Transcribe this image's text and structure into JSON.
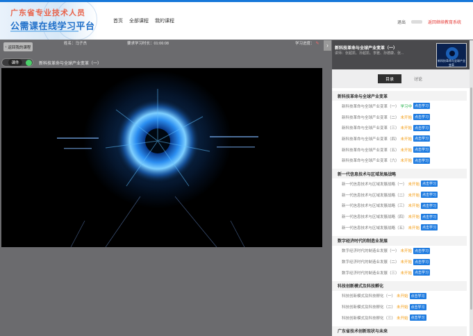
{
  "header": {
    "logo_line1": "广东省专业技术人员",
    "logo_line2": "公需课在线学习平台",
    "nav": [
      "首页",
      "全部课程",
      "我的课程"
    ],
    "logout": "退出",
    "home_link": "返回继续教育系统"
  },
  "player": {
    "back_label": "返回我的课程",
    "name_label": "姓名：马子杰",
    "duration_label": "要求学习时长：01:06:08",
    "progress_label": "学习进度：",
    "toggle_label": "课件",
    "now_playing": "新科技革命与全球产业变革（一）"
  },
  "panel": {
    "course_title": "新科技革命与全球产业变革（一）",
    "teachers": "讲师：张超凯、孙超凯、李雅、孙德康、张...",
    "thumb_text": "新科技革命与全球产业变革",
    "tabs": [
      "目录",
      "讨论"
    ]
  },
  "catalog": [
    {
      "section": "新科技革命与全球产业变革",
      "items": [
        {
          "title": "新科技革命与全球产业变革（一）",
          "status": "学习中",
          "state": "learning",
          "btn": "点击学习"
        },
        {
          "title": "新科技革命与全球产业变革（二）",
          "status": "未开始",
          "state": "notlearn",
          "btn": "点击学习"
        },
        {
          "title": "新科技革命与全球产业变革（三）",
          "status": "未开始",
          "state": "notlearn",
          "btn": "点击学习"
        },
        {
          "title": "新科技革命与全球产业变革（四）",
          "status": "未开始",
          "state": "notlearn",
          "btn": "点击学习"
        },
        {
          "title": "新科技革命与全球产业变革（五）",
          "status": "未开始",
          "state": "notlearn",
          "btn": "点击学习"
        },
        {
          "title": "新科技革命与全球产业变革（六）",
          "status": "未开始",
          "state": "notlearn",
          "btn": "点击学习"
        }
      ]
    },
    {
      "section": "新一代信息技术与区域发展战略",
      "items": [
        {
          "title": "新一代信息技术与区域发展战略（一）",
          "status": "未开始",
          "state": "notlearn",
          "btn": "点击学习"
        },
        {
          "title": "新一代信息技术与区域发展战略（二）",
          "status": "未开始",
          "state": "notlearn",
          "btn": "点击学习"
        },
        {
          "title": "新一代信息技术与区域发展战略（三）",
          "status": "未开始",
          "state": "notlearn",
          "btn": "点击学习"
        },
        {
          "title": "新一代信息技术与区域发展战略（四）",
          "status": "未开始",
          "state": "notlearn",
          "btn": "点击学习"
        },
        {
          "title": "新一代信息技术与区域发展战略（五）",
          "status": "未开始",
          "state": "notlearn",
          "btn": "点击学习"
        }
      ]
    },
    {
      "section": "数字经济时代的制造业发展",
      "items": [
        {
          "title": "数字经济时代的制造业发展（一）",
          "status": "未开始",
          "state": "notlearn",
          "btn": "点击学习"
        },
        {
          "title": "数字经济时代的制造业发展（二）",
          "status": "未开始",
          "state": "notlearn",
          "btn": "点击学习"
        },
        {
          "title": "数字经济时代的制造业发展（三）",
          "status": "未开始",
          "state": "notlearn",
          "btn": "点击学习"
        }
      ]
    },
    {
      "section": "科技创新模式及科技孵化",
      "items": [
        {
          "title": "科技创新模式及科技孵化（一）",
          "status": "未开始",
          "state": "notlearn",
          "btn": "点击学习"
        },
        {
          "title": "科技创新模式及科技孵化（二）",
          "status": "未开始",
          "state": "notlearn",
          "btn": "点击学习"
        },
        {
          "title": "科技创新模式及科技孵化（三）",
          "status": "未开始",
          "state": "notlearn",
          "btn": "点击学习"
        }
      ]
    },
    {
      "section": "广东省技术创新现状与未来",
      "items": []
    }
  ],
  "colors": {
    "accent": "#1677d9",
    "learning": "#25b24a",
    "not_started": "#f39c12",
    "button": "#1e7be0",
    "home_link": "#e53935"
  }
}
